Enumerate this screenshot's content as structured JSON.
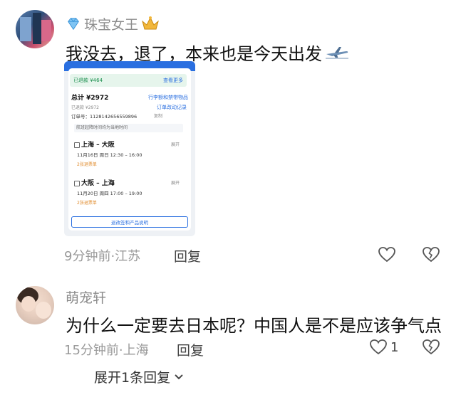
{
  "comments": [
    {
      "username": "珠宝女王",
      "text": "我没去，退了，本来也是今天出发",
      "meta": "9分钟前·江苏",
      "reply_label": "回复",
      "attachment": {
        "refund_label": "已退款 ¥464",
        "more_label": "查看更多",
        "total_label": "总计 ¥2972",
        "luggage_label": "行李额和禁带物品",
        "refunded_label": "已退款 ¥2972",
        "change_label": "订单改动记录",
        "order_label": "订单号：1128142656559896",
        "copy_label": "复制",
        "note": "航班起降时间均为当地时间",
        "flights": [
          {
            "route": "上海 – 大阪",
            "expand": "展开",
            "time": "11月16日 周日 12:30 – 16:00",
            "status": "2张退票单"
          },
          {
            "route": "大阪 – 上海",
            "expand": "展开",
            "time": "11月20日 周四 17:00 – 19:00",
            "status": "2张退票单"
          }
        ],
        "button": "退改签和产品说明"
      }
    },
    {
      "username": "萌宠轩",
      "text": "为什么一定要去日本呢？中国人是不是应该争气点",
      "meta": "15分钟前·上海",
      "reply_label": "回复",
      "likes": "1"
    }
  ],
  "expand_label": "展开1条回复",
  "icons": [
    "gem-icon",
    "crown-icon",
    "plane-icon",
    "heart-icon",
    "broken-heart-icon",
    "chevron-down-icon"
  ],
  "colors": {
    "username": "#8c8c8c",
    "meta": "#9a9a9a",
    "accent_blue": "#2a6fe0"
  }
}
